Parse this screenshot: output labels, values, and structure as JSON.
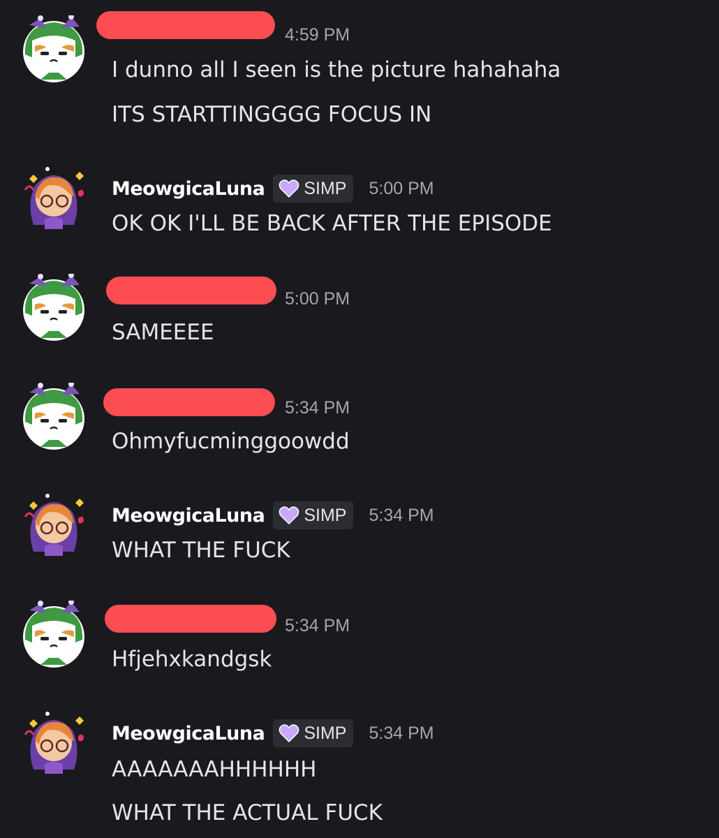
{
  "users": {
    "redacted": {
      "name_shown": ""
    },
    "luna": {
      "name": "MeowgicaLuna",
      "badge": "SIMP"
    }
  },
  "messages": [
    {
      "author": "redacted",
      "time": "4:59 PM",
      "lines": [
        "I dunno all I seen is the picture hahahaha",
        "ITS STARTTINGGGG FOCUS IN"
      ]
    },
    {
      "author": "luna",
      "time": "5:00 PM",
      "lines": [
        "OK OK I'LL BE BACK AFTER THE EPISODE"
      ]
    },
    {
      "author": "redacted",
      "time": "5:00 PM",
      "lines": [
        "SAMEEEE"
      ]
    },
    {
      "author": "redacted",
      "time": "5:34 PM",
      "lines": [
        "Ohmyfucminggoowdd"
      ]
    },
    {
      "author": "luna",
      "time": "5:34 PM",
      "lines": [
        "WHAT THE FUCK"
      ]
    },
    {
      "author": "redacted",
      "time": "5:34 PM",
      "lines": [
        "Hfjehxkandgsk"
      ]
    },
    {
      "author": "luna",
      "time": "5:34 PM",
      "lines": [
        "AAAAAAAHHHHHH",
        "WHAT THE ACTUAL FUCK"
      ]
    }
  ],
  "icons": {
    "dino_avatar": "dino-hood-cat-avatar",
    "luna_avatar": "witch-girl-avatar",
    "badge_icon": "purple-heart-icon"
  },
  "colors": {
    "background": "#1a1a1e",
    "redaction": "#fb4d52",
    "badge_bg": "#2b2d33",
    "timestamp": "#a4a6ad"
  }
}
